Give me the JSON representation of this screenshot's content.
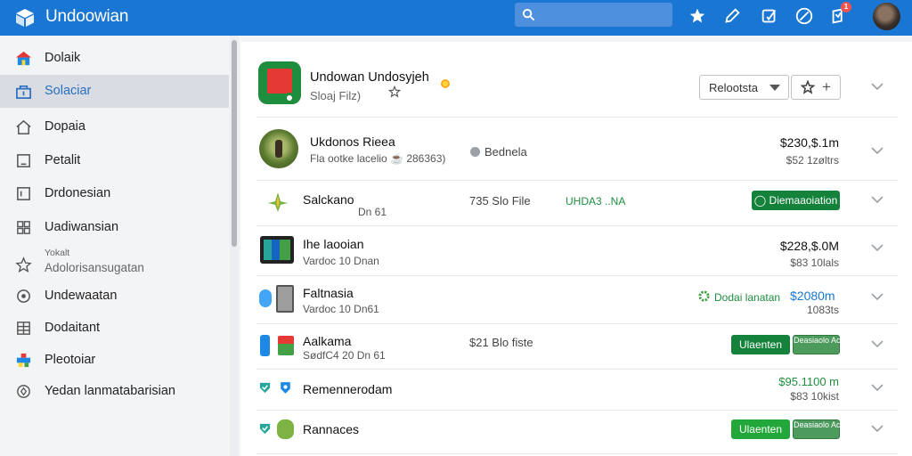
{
  "app": {
    "title": "Undoowian"
  },
  "search": {
    "placeholder": ""
  },
  "toolbar": {
    "notification_count": "1"
  },
  "sidebar": {
    "items": [
      {
        "label": "Dolaik",
        "icon": "colored-home-icon"
      },
      {
        "label": "Solaciar",
        "icon": "store-icon",
        "active": true
      },
      {
        "label": "Dopaia",
        "icon": "home-icon"
      },
      {
        "label": "Petalit",
        "icon": "tablet-icon"
      },
      {
        "label": "Drdonesian",
        "icon": "window-icon"
      },
      {
        "label": "Uadiwansian",
        "icon": "grid-icon"
      },
      {
        "label": "Adolorisansugatan",
        "sub": "Yokalt",
        "icon": "star-icon"
      },
      {
        "label": "Undewaatan",
        "icon": "circle-icon"
      },
      {
        "label": "Dodaitant",
        "icon": "list-icon"
      },
      {
        "label": "Pleotoiar",
        "icon": "colored-app-icon"
      },
      {
        "label": "Yedan lanmatabarisian",
        "icon": "diamond-icon"
      }
    ]
  },
  "header": {
    "title": "Undowan Undosyjeh",
    "subtitle": "Sloaj Filz)",
    "select_label": "Relootsta",
    "add_symbol": "+"
  },
  "rows": [
    {
      "name": "Ukdonos Rieea",
      "sub": "Fla ootke lacelio ☕ 286363)",
      "mid": "Bednela",
      "price": "$230,$.1m",
      "price_sub": "$52 1zøltrs"
    },
    {
      "name": "Salckano",
      "sub": "Dn 61",
      "mid": "735 Slo File",
      "green_text": "UHDA3 ..NA",
      "pill": "Diemaaoiation"
    },
    {
      "name": "Ihe laooian",
      "sub": "Vardoc 10 Dnan",
      "price": "$228,$.0M",
      "price_sub": "$83 10lals"
    },
    {
      "name": "Faltnasia",
      "sub": "Vardoc 10 Dn61",
      "status": "Dodai lanatan",
      "blue_price": "$2080m",
      "price_sub": "1083ts"
    },
    {
      "name": "Aalkama",
      "sub": "SødfC4 20 Dn 61",
      "mid": "$21 Blo fiste",
      "pill": "Ulaenten",
      "pill2": "Deasiaolo Acetecer"
    },
    {
      "name": "Remennerodam",
      "green_price": "$95.1100 m",
      "price_sub": "$83 10kist"
    },
    {
      "name": "Rannaces",
      "pill": "Ulaenten",
      "pill2": "Deasiaolo Acetecer"
    }
  ],
  "colors": {
    "topbar": "#1976d2",
    "accent_green": "#1e8e3e",
    "active_blue": "#2a6fc0"
  }
}
